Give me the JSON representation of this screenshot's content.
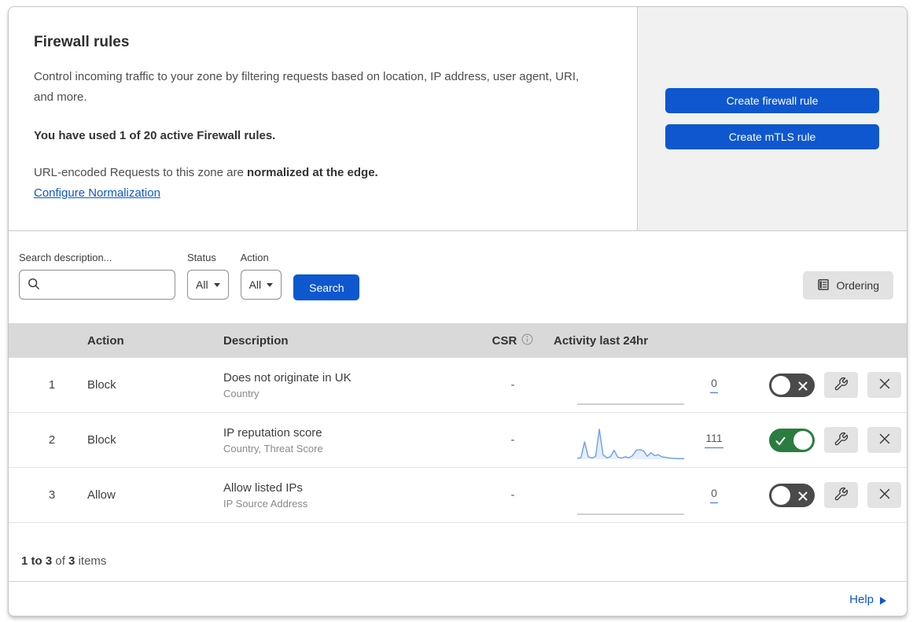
{
  "header": {
    "title": "Firewall rules",
    "description": "Control incoming traffic to your zone by filtering requests based on location, IP address, user agent, URI, and more.",
    "usage_bold": "You have used 1 of 20 active Firewall rules.",
    "normalization_text": "URL-encoded Requests to this zone are ",
    "normalization_bold": "normalized at the edge.",
    "normalization_link": "Configure Normalization",
    "create_firewall_button": "Create firewall rule",
    "create_mtls_button": "Create mTLS rule"
  },
  "filters": {
    "search_label": "Search description...",
    "search_placeholder": "",
    "search_value": "",
    "status_label": "Status",
    "status_value": "All",
    "action_label": "Action",
    "action_value": "All",
    "search_button": "Search",
    "ordering_button": "Ordering"
  },
  "table": {
    "headers": {
      "action": "Action",
      "description": "Description",
      "csr": "CSR",
      "activity": "Activity last 24hr"
    },
    "rows": [
      {
        "priority": "1",
        "action": "Block",
        "description": "Does not originate in UK",
        "criteria": "Country",
        "csr": "-",
        "activity_count": "0",
        "enabled": false,
        "sparkline": []
      },
      {
        "priority": "2",
        "action": "Block",
        "description": "IP reputation score",
        "criteria": "Country, Threat Score",
        "csr": "-",
        "activity_count": "111",
        "enabled": true,
        "sparkline": [
          3,
          5,
          58,
          8,
          4,
          10,
          100,
          15,
          5,
          8,
          30,
          7,
          4,
          8,
          5,
          12,
          30,
          32,
          28,
          10,
          22,
          12,
          15,
          8,
          6,
          4,
          3,
          2,
          2,
          2
        ]
      },
      {
        "priority": "3",
        "action": "Allow",
        "description": "Allow listed IPs",
        "criteria": "IP Source Address",
        "csr": "-",
        "activity_count": "0",
        "enabled": false,
        "sparkline": []
      }
    ]
  },
  "footer": {
    "range_bold": "1 to 3",
    "of_text": "of",
    "total_bold": "3",
    "items_text": "items",
    "help_label": "Help"
  },
  "colors": {
    "accent_blue": "#0e57cf",
    "toggle_on_green": "#2a7d3f",
    "toggle_off_gray": "#4a4a4a",
    "sparkline_blue": "#6d9fe8",
    "table_header_gray": "#d9d9d9",
    "side_panel_gray": "#f1f1f1"
  }
}
